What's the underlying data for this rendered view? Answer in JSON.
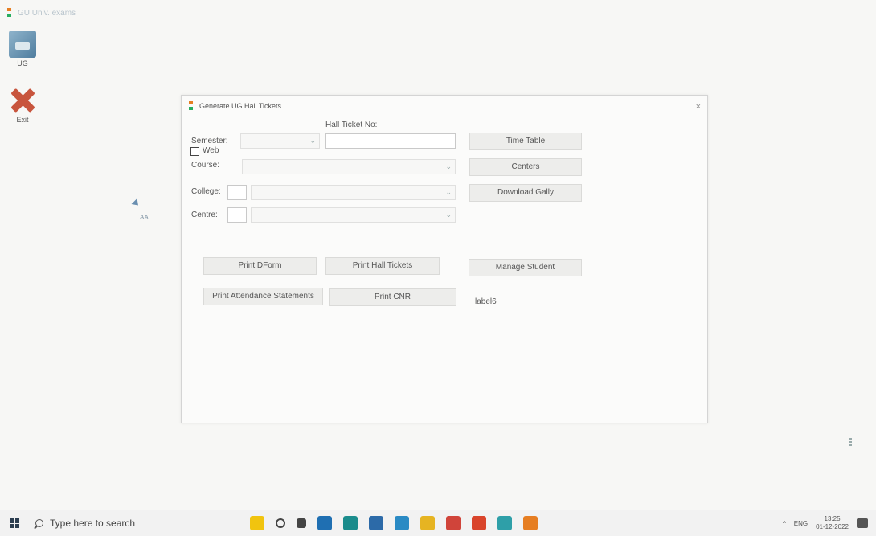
{
  "desktop": {
    "app_title": "GU Univ. exams",
    "icons": [
      {
        "label": "UG",
        "icon": "ug-app-icon"
      },
      {
        "label": "Exit",
        "icon": "exit-x-icon"
      }
    ],
    "cursor_label": "AA"
  },
  "dialog": {
    "title": "Generate UG Hall Tickets",
    "close_glyph": "×",
    "hall_ticket_label": "Hall Ticket No:",
    "hall_ticket_value": "",
    "semester_label": "Semester:",
    "web_label": "Web",
    "course_label": "Course:",
    "college_label": "College:",
    "centre_label": "Centre:",
    "combo_arrow": "⌄",
    "buttons": {
      "time_table": "Time Table",
      "centers": "Centers",
      "download_gally": "Download Gally",
      "print_dform": "Print DForm",
      "print_hall_tickets": "Print Hall Tickets",
      "manage_student": "Manage Student",
      "print_attendance": "Print Attendance Statements",
      "print_cnr": "Print CNR"
    },
    "status_label": "label6"
  },
  "taskbar": {
    "search_placeholder": "Type here to search",
    "tray_lang": "ENG",
    "tray_caret": "^",
    "clock_time": "13:25",
    "clock_date": "01-12-2022",
    "apps": [
      {
        "icon": "weather-icon",
        "color": "#f1c40f"
      },
      {
        "icon": "cortana-circle-icon",
        "color": "#444444"
      },
      {
        "icon": "task-view-icon",
        "color": "#444444"
      },
      {
        "icon": "mail-icon",
        "color": "#1f6fb2"
      },
      {
        "icon": "edge-icon",
        "color": "#1a8c8c"
      },
      {
        "icon": "store-icon",
        "color": "#2c6aa8"
      },
      {
        "icon": "chrome-icon",
        "color": "#2a8ac4"
      },
      {
        "icon": "file-explorer-icon",
        "color": "#e6b422"
      },
      {
        "icon": "chrome-alt-icon",
        "color": "#d0443a"
      },
      {
        "icon": "office-icon",
        "color": "#d9442b"
      },
      {
        "icon": "sharex-icon",
        "color": "#2e9fa8"
      },
      {
        "icon": "exam-app-icon",
        "color": "#e67e22"
      }
    ]
  }
}
